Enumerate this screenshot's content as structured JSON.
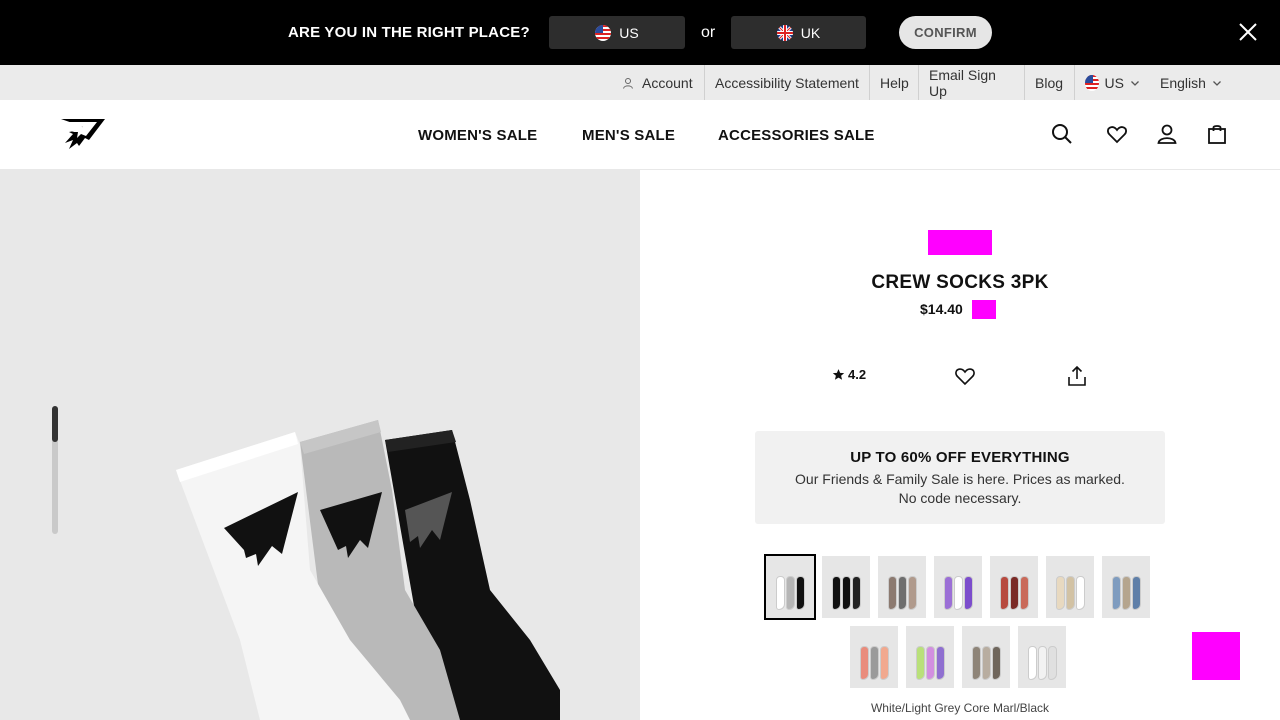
{
  "region_banner": {
    "question": "ARE YOU IN THE RIGHT PLACE?",
    "us_label": "US",
    "or_label": "or",
    "uk_label": "UK",
    "confirm_label": "CONFIRM",
    "close_icon": "close-icon"
  },
  "utility_bar": {
    "account": "Account",
    "accessibility": "Accessibility Statement",
    "help": "Help",
    "email_signup": "Email Sign Up",
    "blog": "Blog",
    "country": "US",
    "language": "English"
  },
  "header": {
    "nav": [
      "WOMEN'S SALE",
      "MEN'S SALE",
      "ACCESSORIES SALE"
    ],
    "icons": [
      "search-icon",
      "heart-icon",
      "user-icon",
      "bag-icon"
    ]
  },
  "product": {
    "title": "CREW SOCKS 3PK",
    "price": "$14.40",
    "rating": "4.2",
    "colour_name": "White/Light Grey Core Marl/Black"
  },
  "promo": {
    "title": "UP TO 60% OFF EVERYTHING",
    "line1": "Our Friends & Family Sale is here. Prices as marked.",
    "line2": "No code necessary."
  },
  "swatches": [
    {
      "colors": [
        "#ffffff",
        "#b5b5b5",
        "#111111"
      ],
      "selected": true
    },
    {
      "colors": [
        "#111111",
        "#111111",
        "#222222"
      ],
      "selected": false
    },
    {
      "colors": [
        "#8c7a70",
        "#6e6e6e",
        "#b09a8c"
      ],
      "selected": false
    },
    {
      "colors": [
        "#9b6fd6",
        "#ffffff",
        "#7c4dcc"
      ],
      "selected": false
    },
    {
      "colors": [
        "#b74a3f",
        "#7a2a26",
        "#c96a5a"
      ],
      "selected": false
    },
    {
      "colors": [
        "#e8d9c0",
        "#d2c2a4",
        "#ffffff"
      ],
      "selected": false
    },
    {
      "colors": [
        "#7f9cbf",
        "#b5a58e",
        "#5f7fa8"
      ],
      "selected": false
    },
    {
      "colors": [
        "#e98c7c",
        "#9a9a9a",
        "#f1a98f"
      ],
      "selected": false
    },
    {
      "colors": [
        "#b9e07a",
        "#d28fe0",
        "#8f6fd0"
      ],
      "selected": false
    },
    {
      "colors": [
        "#8e8478",
        "#b8ada0",
        "#6f665c"
      ],
      "selected": false
    },
    {
      "colors": [
        "#ffffff",
        "#f2f2f2",
        "#e0e0e0"
      ],
      "selected": false
    }
  ],
  "colors": {
    "banner_bg": "#000000",
    "utility_bg": "#ebebeb",
    "gallery_bg": "#e8e8e8",
    "placeholder": "#ff00ff"
  }
}
